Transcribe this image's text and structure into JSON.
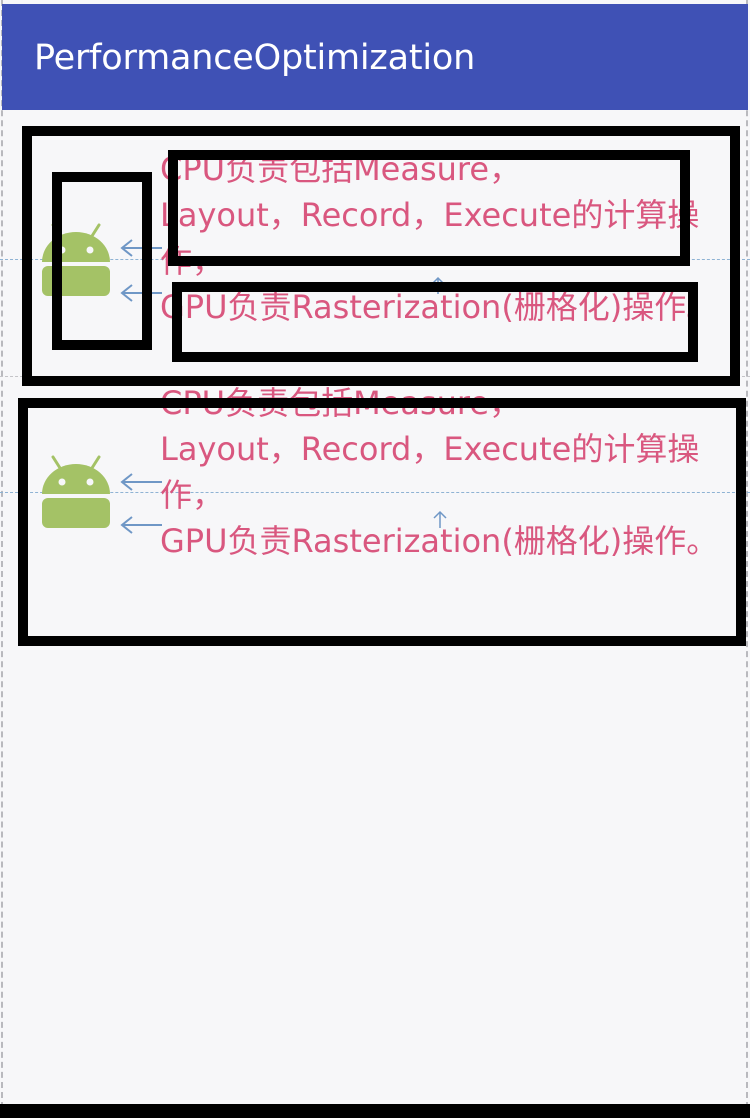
{
  "app_bar": {
    "title": "PerformanceOptimization",
    "color": "#3f51b5"
  },
  "items": [
    {
      "icon": "android-icon",
      "text": "CPU负责包括Measure，\nLayout，Record，Execute的计算操作，\nGPU负责Rasterization(栅格化)操作。"
    },
    {
      "icon": "android-icon",
      "text": "CPU负责包括Measure，\nLayout，Record，Execute的计算操作，\nGPU负责Rasterization(栅格化)操作。"
    }
  ],
  "colors": {
    "text": "#d9577f",
    "android": "#a4c266",
    "highlight_box": "#000000",
    "guide": "#8fb3d4"
  }
}
